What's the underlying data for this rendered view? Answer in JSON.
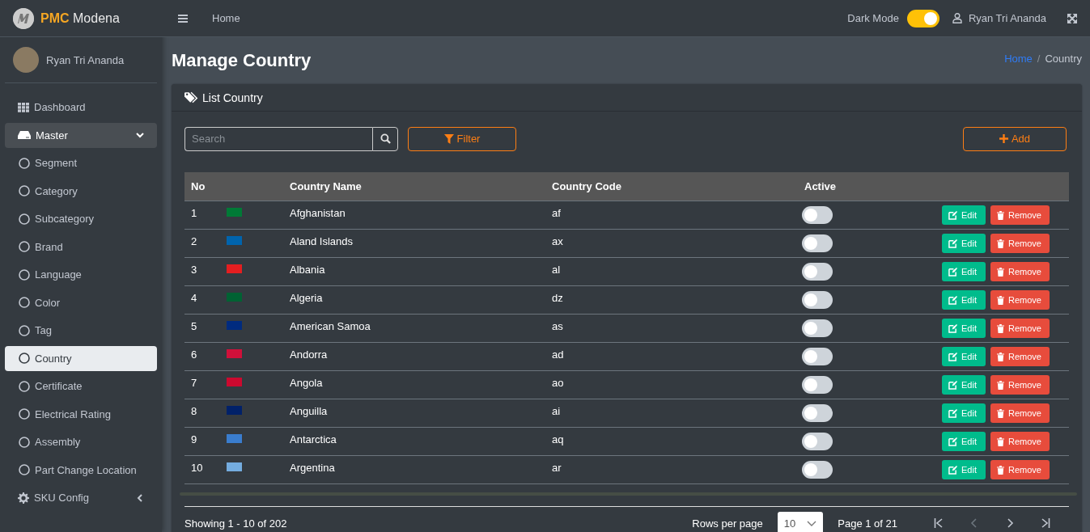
{
  "brand": {
    "accent": "PMC",
    "name": "Modena"
  },
  "sidebar": {
    "user_name": "Ryan Tri Ananda",
    "items": [
      {
        "label": "Dashboard",
        "kind": "page",
        "selected": false
      },
      {
        "label": "Master",
        "kind": "group",
        "expanded": true,
        "selected": false,
        "children": [
          {
            "label": "Segment",
            "selected": false
          },
          {
            "label": "Category",
            "selected": false
          },
          {
            "label": "Subcategory",
            "selected": false
          },
          {
            "label": "Brand",
            "selected": false
          },
          {
            "label": "Language",
            "selected": false
          },
          {
            "label": "Color",
            "selected": false
          },
          {
            "label": "Tag",
            "selected": false
          },
          {
            "label": "Country",
            "selected": true
          },
          {
            "label": "Certificate",
            "selected": false
          },
          {
            "label": "Electrical Rating",
            "selected": false
          },
          {
            "label": "Assembly",
            "selected": false
          },
          {
            "label": "Part Change Location",
            "selected": false
          }
        ]
      },
      {
        "label": "SKU Config",
        "kind": "group",
        "expanded": false,
        "selected": false
      }
    ]
  },
  "topbar": {
    "home": "Home",
    "dark_mode_label": "Dark Mode",
    "dark_mode_on": true,
    "user_name": "Ryan Tri Ananda"
  },
  "page": {
    "title": "Manage Country",
    "breadcrumb_separator": "/",
    "breadcrumb": [
      {
        "label": "Home",
        "link": true
      },
      {
        "label": "Country",
        "link": false
      }
    ]
  },
  "card": {
    "title": "List Country",
    "search": {
      "placeholder": "Search"
    },
    "filter_button": "Filter",
    "add_button": "Add"
  },
  "table": {
    "columns": [
      "No",
      "",
      "Country Name",
      "Country Code",
      "Active",
      ""
    ],
    "rows": [
      {
        "no": "1",
        "color": "#007a36",
        "name": "Afghanistan",
        "code": "af",
        "active": false,
        "edit": "Edit",
        "remove": "Remove"
      },
      {
        "no": "2",
        "color": "#0064ad",
        "name": "Aland Islands",
        "code": "ax",
        "active": false,
        "edit": "Edit",
        "remove": "Remove"
      },
      {
        "no": "3",
        "color": "#e41e20",
        "name": "Albania",
        "code": "al",
        "active": false,
        "edit": "Edit",
        "remove": "Remove"
      },
      {
        "no": "4",
        "color": "#006233",
        "name": "Algeria",
        "code": "dz",
        "active": false,
        "edit": "Edit",
        "remove": "Remove"
      },
      {
        "no": "5",
        "color": "#002b7f",
        "name": "American Samoa",
        "code": "as",
        "active": false,
        "edit": "Edit",
        "remove": "Remove"
      },
      {
        "no": "6",
        "color": "#d0103a",
        "name": "Andorra",
        "code": "ad",
        "active": false,
        "edit": "Edit",
        "remove": "Remove"
      },
      {
        "no": "7",
        "color": "#cc092f",
        "name": "Angola",
        "code": "ao",
        "active": false,
        "edit": "Edit",
        "remove": "Remove"
      },
      {
        "no": "8",
        "color": "#012169",
        "name": "Anguilla",
        "code": "ai",
        "active": false,
        "edit": "Edit",
        "remove": "Remove"
      },
      {
        "no": "9",
        "color": "#3a7dce",
        "name": "Antarctica",
        "code": "aq",
        "active": false,
        "edit": "Edit",
        "remove": "Remove"
      },
      {
        "no": "10",
        "color": "#74acdf",
        "name": "Argentina",
        "code": "ar",
        "active": false,
        "edit": "Edit",
        "remove": "Remove"
      }
    ]
  },
  "footer": {
    "showing": "Showing 1 - 10 of 202",
    "rows_per_page_label": "Rows per page",
    "rows_per_page": "10",
    "page_info": "Page 1 of 21"
  }
}
